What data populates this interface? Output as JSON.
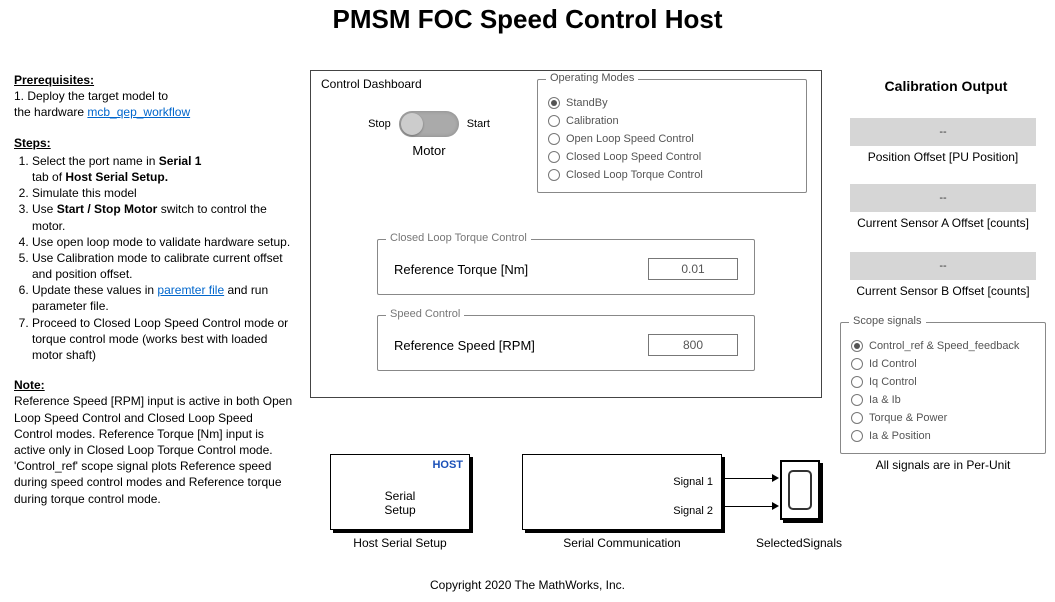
{
  "title": "PMSM FOC Speed Control Host",
  "left": {
    "prereq_hd": "Prerequisites:",
    "prereq_line_a": "1. Deploy the target model to",
    "prereq_line_b": "    the hardware ",
    "prereq_link": "mcb_qep_workflow",
    "steps_hd": "Steps:",
    "step1_a": "Select the port name in ",
    "step1_b1": "Serial 1",
    "step1_c": "tab of ",
    "step1_b2": "Host Serial Setup.",
    "step2": "Simulate this model",
    "step3_a": "Use ",
    "step3_b": "Start / Stop Motor",
    "step3_c": " switch to control the motor.",
    "step4": "Use open loop mode to validate hardware setup.",
    "step5": "Use Calibration mode to calibrate current offset and position offset.",
    "step6_a": "Update these values in ",
    "step6_link": "paremter file",
    "step6_b": " and run parameter file.",
    "step7": "Proceed to  Closed Loop Speed Control mode or torque control mode (works best with loaded motor shaft)",
    "note_hd": "Note:",
    "note_body": "Reference Speed [RPM] input is active in both Open Loop Speed Control and Closed Loop Speed Control modes. Reference Torque [Nm] input is active only in Closed Loop Torque Control mode.\n'Control_ref' scope signal plots Reference speed during speed control modes and Reference torque during torque control mode."
  },
  "dash": {
    "title": "Control Dashboard",
    "stop": "Stop",
    "start": "Start",
    "motor": "Motor",
    "modes_title": "Operating Modes",
    "modes": [
      {
        "label": "StandBy",
        "selected": true
      },
      {
        "label": "Calibration",
        "selected": false
      },
      {
        "label": "Open Loop Speed Control",
        "selected": false
      },
      {
        "label": "Closed Loop Speed Control",
        "selected": false
      },
      {
        "label": "Closed Loop Torque Control",
        "selected": false
      }
    ],
    "torque_title": "Closed Loop Torque Control",
    "torque_lbl": "Reference Torque [Nm]",
    "torque_val": "0.01",
    "speed_title": "Speed Control",
    "speed_lbl": "Reference Speed [RPM]",
    "speed_val": "800"
  },
  "blocks": {
    "host_tag": "HOST",
    "host_txt_a": "Serial",
    "host_txt_b": "Setup",
    "host_caption": "Host Serial Setup",
    "comm_sig1": "Signal 1",
    "comm_sig2": "Signal 2",
    "comm_caption": "Serial Communication",
    "scope_caption": "SelectedSignals"
  },
  "right": {
    "calib_title": "Calibration Output",
    "dash": "--",
    "lbl1": "Position Offset [PU Position]",
    "lbl2": "Current Sensor A Offset [counts]",
    "lbl3": "Current Sensor B Offset [counts]",
    "scopesig_title": "Scope signals",
    "signals": [
      {
        "label": "Control_ref & Speed_feedback",
        "selected": true
      },
      {
        "label": "Id Control",
        "selected": false
      },
      {
        "label": "Iq Control",
        "selected": false
      },
      {
        "label": "Ia & Ib",
        "selected": false
      },
      {
        "label": "Torque  & Power",
        "selected": false
      },
      {
        "label": "Ia & Position",
        "selected": false
      }
    ],
    "allsig": "All signals are in Per-Unit"
  },
  "copyright": "Copyright 2020 The MathWorks, Inc."
}
